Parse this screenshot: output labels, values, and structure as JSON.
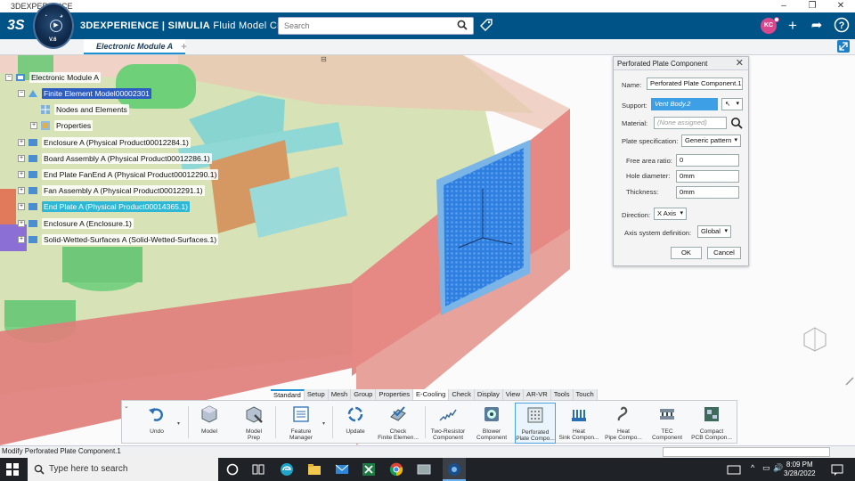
{
  "window": {
    "title": "3DEXPERIENCE"
  },
  "header": {
    "brand_prefix": "3DEXPERIENCE | SIMULIA",
    "app_name": "Fluid Model Creation",
    "search_placeholder": "Search",
    "avatar_initials": "KC",
    "compass_version": "V.6"
  },
  "tabs": {
    "active_label": "Electronic Module A",
    "add_label": "+"
  },
  "tree": {
    "root": "Electronic Module A",
    "items": [
      {
        "label": "Finite Element Model00002301",
        "state": "selected"
      },
      {
        "label": "Nodes and Elements"
      },
      {
        "label": "Properties"
      },
      {
        "label": "Enclosure A (Physical Product00012284.1)"
      },
      {
        "label": "Board Assembly A (Physical Product00012286.1)"
      },
      {
        "label": "End Plate FanEnd A (Physical Product00012290.1)"
      },
      {
        "label": "Fan Assembly A (Physical Product00012291.1)"
      },
      {
        "label": "End Plate A (Physical Product00014365.1)",
        "state": "highlighted"
      },
      {
        "label": "Enclosure A (Enclosure.1)"
      },
      {
        "label": "Solid-Wetted-Surfaces A (Solid-Wetted-Surfaces.1)"
      }
    ]
  },
  "dialog": {
    "title": "Perforated Plate Component",
    "name_label": "Name:",
    "name_value": "Perforated Plate Component.1",
    "support_label": "Support:",
    "support_value": "Vent Body.2",
    "material_label": "Material:",
    "material_value": "(None assigned)",
    "plate_spec_label": "Plate specification:",
    "plate_spec_value": "Generic pattern",
    "free_area_label": "Free area ratio:",
    "free_area_value": "0",
    "hole_diameter_label": "Hole diameter:",
    "hole_diameter_value": "0mm",
    "thickness_label": "Thickness:",
    "thickness_value": "0mm",
    "direction_label": "Direction:",
    "direction_value": "X Axis",
    "axis_system_label": "Axis system definition:",
    "axis_system_value": "Global",
    "ok_label": "OK",
    "cancel_label": "Cancel"
  },
  "toolbar_tabs": [
    "Standard",
    "Setup",
    "Mesh",
    "Group",
    "Properties",
    "E-Cooling",
    "Check",
    "Display",
    "View",
    "AR-VR",
    "Tools",
    "Touch"
  ],
  "toolbar_active_tab": "E-Cooling",
  "tools": [
    {
      "l1": "Undo",
      "l2": ""
    },
    {
      "l1": "Model",
      "l2": ""
    },
    {
      "l1": "Model",
      "l2": "Prep"
    },
    {
      "l1": "Feature",
      "l2": "Manager"
    },
    {
      "l1": "Update",
      "l2": ""
    },
    {
      "l1": "Check",
      "l2": "Finite Elemen..."
    },
    {
      "l1": "Two-Resistor",
      "l2": "Component"
    },
    {
      "l1": "Blower",
      "l2": "Component"
    },
    {
      "l1": "Perforated",
      "l2": "Plate Compo..."
    },
    {
      "l1": "Heat",
      "l2": "Sink Compon..."
    },
    {
      "l1": "Heat",
      "l2": "Pipe Compo..."
    },
    {
      "l1": "TEC",
      "l2": "Component"
    },
    {
      "l1": "Compact",
      "l2": "PCB Compon..."
    }
  ],
  "status": {
    "text": "Modify Perforated Plate Component.1"
  },
  "taskbar": {
    "search_placeholder": "Type here to search",
    "time": "8:09 PM",
    "date": "3/28/2022"
  }
}
